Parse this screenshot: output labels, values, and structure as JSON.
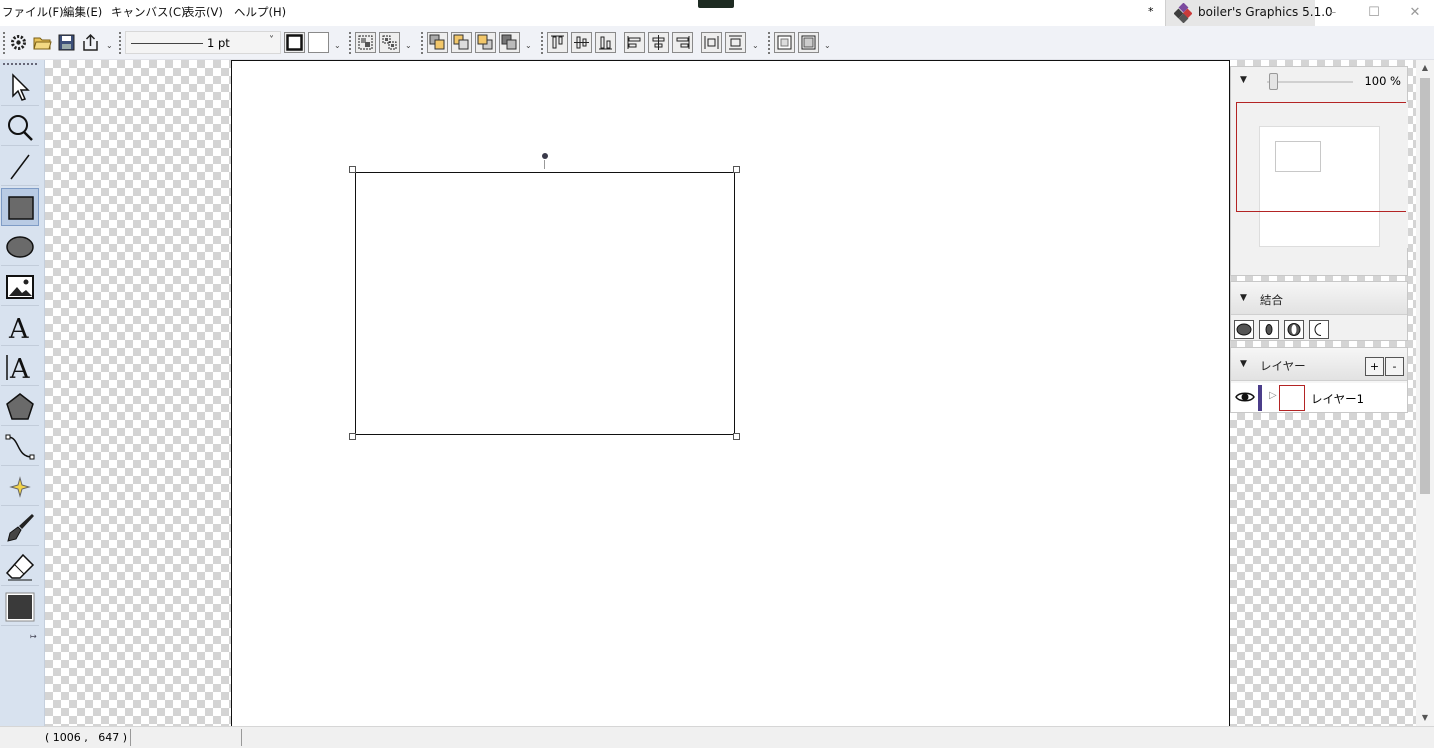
{
  "menu": [
    "ファイル(F)",
    "編集(E)",
    "キャンバス(C)",
    "表示(V)",
    "ヘルプ(H)"
  ],
  "window": {
    "modified_mark": "*",
    "title": "boiler's Graphics 5.1.0",
    "minimize": "–",
    "maximize": "☐",
    "close": "✕"
  },
  "toolbar": {
    "line_width": "1 pt",
    "dropdown_glyph": "⌄",
    "buttons": [
      "settings",
      "open",
      "save",
      "export",
      "fill-stroke",
      "fill-none",
      "group",
      "ungroup",
      "bring-to-front",
      "bring-forward",
      "send-backward",
      "send-to-back",
      "align-top",
      "align-middle",
      "align-bottom",
      "align-left",
      "align-center",
      "align-right",
      "distribute-horizontal",
      "distribute-vertical",
      "flip-horizontal",
      "flip-vertical"
    ]
  },
  "tools": [
    "select",
    "lasso",
    "line",
    "rectangle",
    "ellipse",
    "image",
    "text",
    "vertical-text",
    "polygon",
    "bezier",
    "sparkle",
    "brush",
    "eraser",
    "color-fill"
  ],
  "active_tool": "rectangle",
  "toolbox_more": "↦",
  "zoom": {
    "value": "100 %",
    "level_percent": 100,
    "arrow": "▼"
  },
  "combine": {
    "title": "結合",
    "arrow": "▼",
    "ops": [
      "union",
      "intersect",
      "exclude",
      "subtract"
    ]
  },
  "layers": {
    "title": "レイヤー",
    "arrow": "▼",
    "add": "+",
    "remove": "-",
    "items": [
      {
        "name": "レイヤー1",
        "expand": "▷",
        "color": "#4b3d8a",
        "visible": true
      }
    ]
  },
  "scroll": {
    "up": "▲",
    "down": "▼"
  },
  "status": {
    "coords": "( 1006 ,   647 )"
  }
}
